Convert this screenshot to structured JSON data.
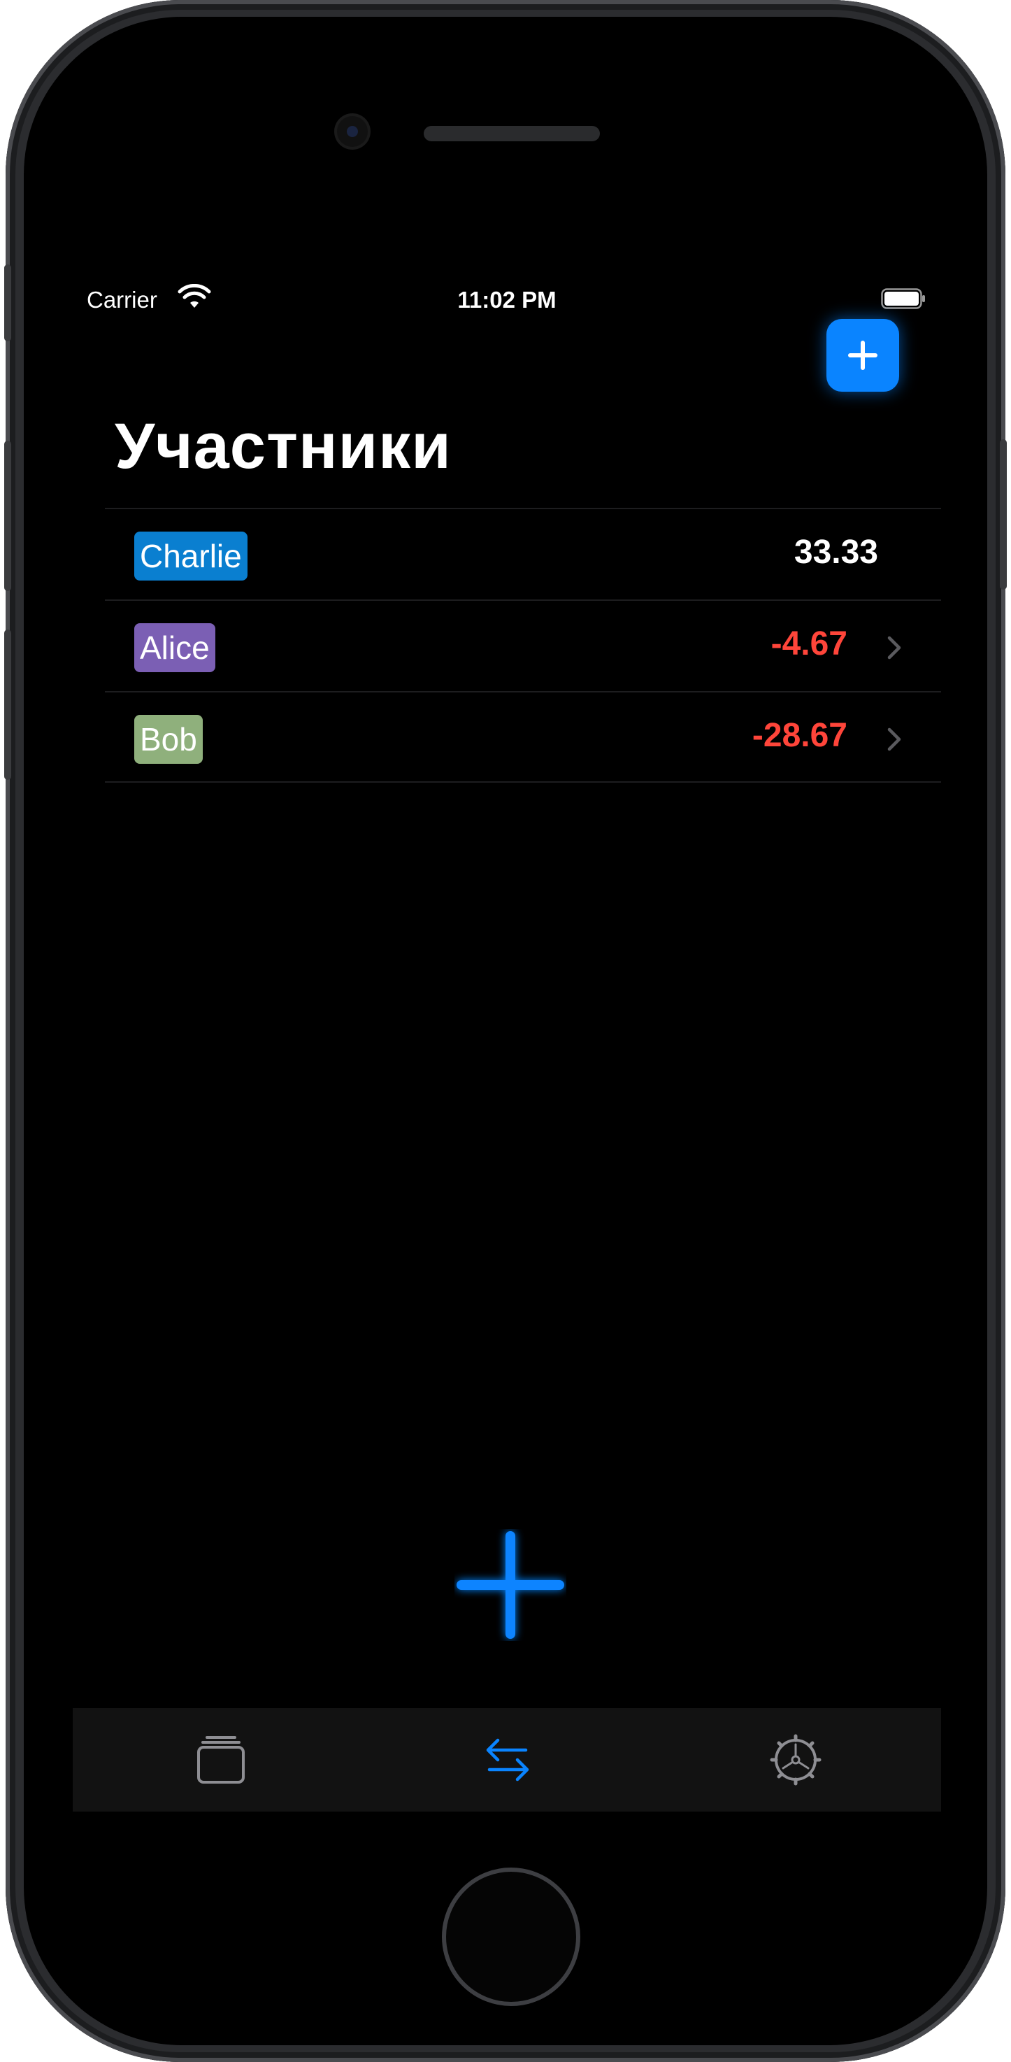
{
  "status_bar": {
    "carrier": "Carrier",
    "time": "11:02 PM"
  },
  "header": {
    "title": "Участники"
  },
  "participants": [
    {
      "name": "Charlie",
      "amount": "33.33",
      "tag_color": "#0a7fd0",
      "amount_color": "#ffffff",
      "has_chevron": false
    },
    {
      "name": "Alice",
      "amount": "-4.67",
      "tag_color": "#7b5fb4",
      "amount_color": "#ff453a",
      "has_chevron": true
    },
    {
      "name": "Bob",
      "amount": "-28.67",
      "tag_color": "#8fb07c",
      "amount_color": "#ff453a",
      "has_chevron": true
    }
  ],
  "tab_bar": {
    "tabs": [
      {
        "icon": "stacked-cards-icon",
        "active": false
      },
      {
        "icon": "transfer-arrows-icon",
        "active": true
      },
      {
        "icon": "gear-icon",
        "active": false
      }
    ]
  },
  "colors": {
    "accent": "#0a84ff",
    "negative": "#ff453a",
    "background": "#000000",
    "tab_bar": "#121212"
  }
}
